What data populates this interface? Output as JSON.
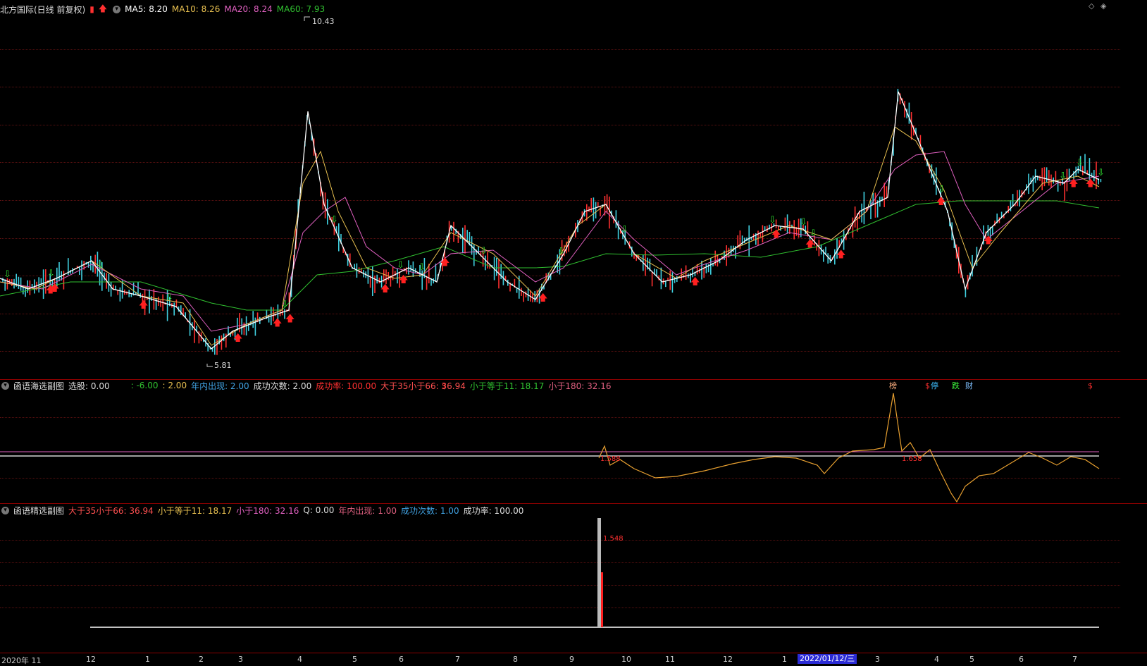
{
  "main_chart": {
    "stock_name": "北方国际(日线 前复权)",
    "ma5": "MA5: 8.20",
    "ma10": "MA10: 8.26",
    "ma20": "MA20: 8.24",
    "ma60": "MA60: 7.93",
    "high_label": "10.43",
    "low_label": "5.81",
    "colors": {
      "ma5": "#ffffff",
      "ma10": "#e8c050",
      "ma20": "#e060c0",
      "ma60": "#30c030"
    }
  },
  "tags": [
    {
      "text": "$",
      "color": "#ff3030"
    },
    {
      "text": "榜",
      "color": "#ffb080"
    },
    {
      "text": "$",
      "color": "#ff3030"
    },
    {
      "text": "停",
      "color": "#40c0ff"
    },
    {
      "text": "跌",
      "color": "#40ff40"
    },
    {
      "text": "财",
      "color": "#80c0ff"
    },
    {
      "text": "$",
      "color": "#ff3030"
    }
  ],
  "sub1": {
    "title": "函语海选副图",
    "xuangu": "选股: 0.00",
    "v1": ": -6.00",
    "v2": ": 2.00",
    "nianei": "年内出现: 2.00",
    "cishu": "成功次数: 2.00",
    "lv": "成功率: 100.00",
    "gt35": "大于35小于66: 36.94",
    "le11": "小于等于11: 18.17",
    "lt180": "小于180: 32.16",
    "label_a": "1.588",
    "label_b": "1.658"
  },
  "sub2": {
    "title": "函语精选副图",
    "gt35": "大于35小于66: 36.94",
    "le11": "小于等于11: 18.17",
    "lt180": "小于180: 32.16",
    "q": "Q: 0.00",
    "nianei": "年内出现: 1.00",
    "cishu": "成功次数: 1.00",
    "lv": "成功率: 100.00",
    "peak_label": "1.548"
  },
  "axis": {
    "labels": [
      "2020年 11",
      "12",
      "1",
      "2",
      "3",
      "4",
      "5",
      "6",
      "7",
      "8",
      "9",
      "10",
      "11",
      "12",
      "1",
      "2022/01/12/三",
      "3",
      "4",
      "5",
      "6",
      "7"
    ]
  }
}
